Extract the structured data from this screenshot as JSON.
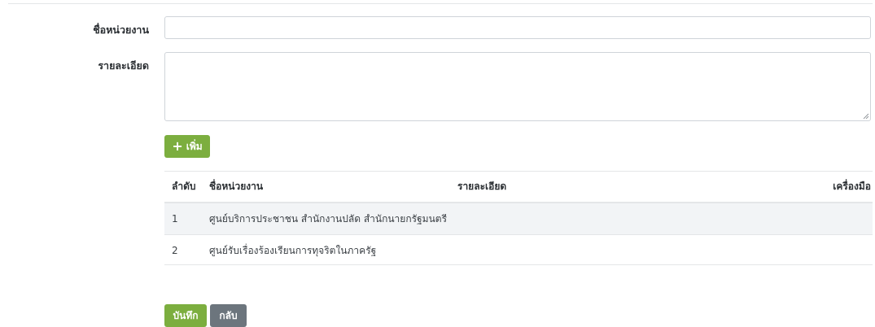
{
  "form": {
    "name_label": "ชื่อหน่วยงาน",
    "name_value": "",
    "detail_label": "รายละเอียด",
    "detail_value": ""
  },
  "add_button": {
    "icon": "plus-icon",
    "label": "เพิ่ม"
  },
  "table": {
    "headers": {
      "no": "ลำดับ",
      "name": "ชื่อหน่วยงาน",
      "detail": "รายละเอียด",
      "tools": "เครื่องมือ"
    },
    "rows": [
      {
        "no": "1",
        "name": "ศูนย์บริการประชาชน สำนักงานปลัด สำนักนายกรัฐมนตรี",
        "detail": ""
      },
      {
        "no": "2",
        "name": "ศูนย์รับเรื่องร้องเรียนการทุจริตในภาครัฐ",
        "detail": ""
      }
    ]
  },
  "actions": {
    "save_label": "บันทึก",
    "back_label": "กลับ"
  },
  "colors": {
    "primary_green": "#7cae3f",
    "secondary_gray": "#6c757d",
    "stripe": "#f2f4f6"
  }
}
